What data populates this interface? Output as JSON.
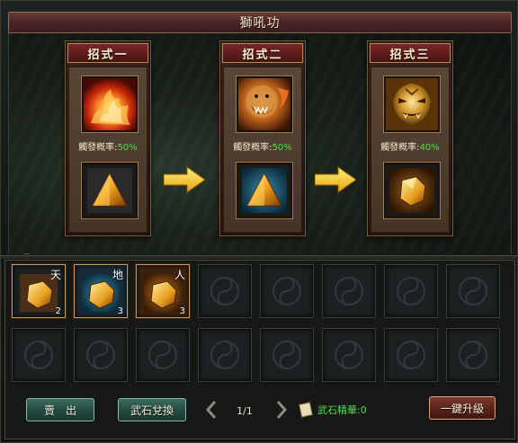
{
  "window": {
    "title": "獅吼功"
  },
  "skills": [
    {
      "label": "招式一",
      "rate_label": "觸發概率:",
      "rate_value": "50%",
      "icon": "flame-burst-icon",
      "stone": "golden-pyramid-stone-icon"
    },
    {
      "label": "招式二",
      "rate_label": "觸發概率:",
      "rate_value": "50%",
      "icon": "roaring-lion-icon",
      "stone": "golden-pyramid-stone-icon"
    },
    {
      "label": "招式三",
      "rate_label": "觸發概率:",
      "rate_value": "40%",
      "icon": "golden-demon-face-icon",
      "stone": "gold-ore-stone-icon"
    }
  ],
  "inventory": {
    "row1": [
      {
        "tag": "天",
        "count": "2",
        "frame": "brown"
      },
      {
        "tag": "地",
        "count": "3",
        "frame": "blue"
      },
      {
        "tag": "人",
        "count": "3",
        "frame": "orange"
      }
    ]
  },
  "footer": {
    "sell_label": "賣　出",
    "exchange_label": "武石兌換",
    "page": "1/1",
    "essence_label": "武石精華:0",
    "upgrade_label": "一鍵升級"
  },
  "colors": {
    "rate_green": "#4fdc4f",
    "title_red": "#7a2626",
    "button_green": "#2f5a4e",
    "button_red": "#5a2218"
  }
}
